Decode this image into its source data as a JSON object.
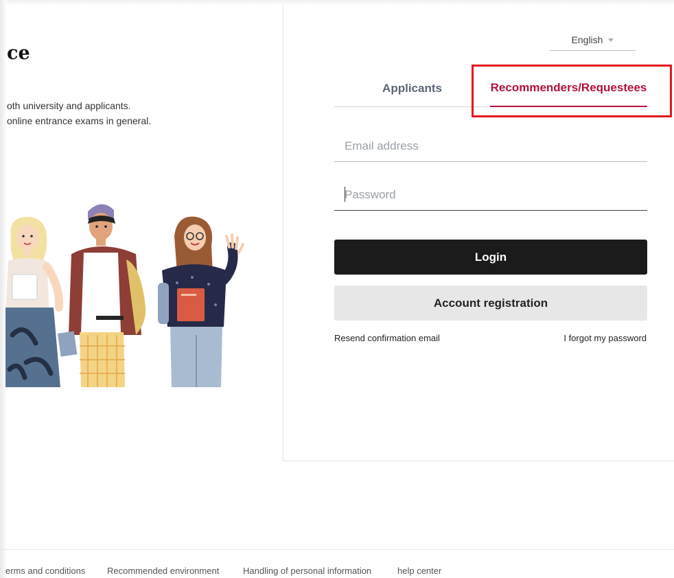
{
  "hero": {
    "title": "ce",
    "desc_line1": "oth university and applicants.",
    "desc_line2": "online entrance exams in general."
  },
  "language": {
    "selected": "English"
  },
  "tabs": [
    {
      "label": "Applicants",
      "active": false
    },
    {
      "label": "Recommenders/Requestees",
      "active": true
    }
  ],
  "form": {
    "email_placeholder": "Email address",
    "email_value": "",
    "password_placeholder": "Password",
    "password_value": "",
    "login_label": "Login",
    "register_label": "Account registration",
    "resend_label": "Resend confirmation email",
    "forgot_label": "I forgot my password"
  },
  "footer": {
    "links": [
      "erms and conditions",
      "Recommended environment",
      "Handling of personal information",
      "help center"
    ]
  },
  "colors": {
    "accent": "#b4123a",
    "highlight": "#e3171e",
    "primary_button": "#1b1b1b",
    "secondary_button": "#e7e7e7"
  }
}
